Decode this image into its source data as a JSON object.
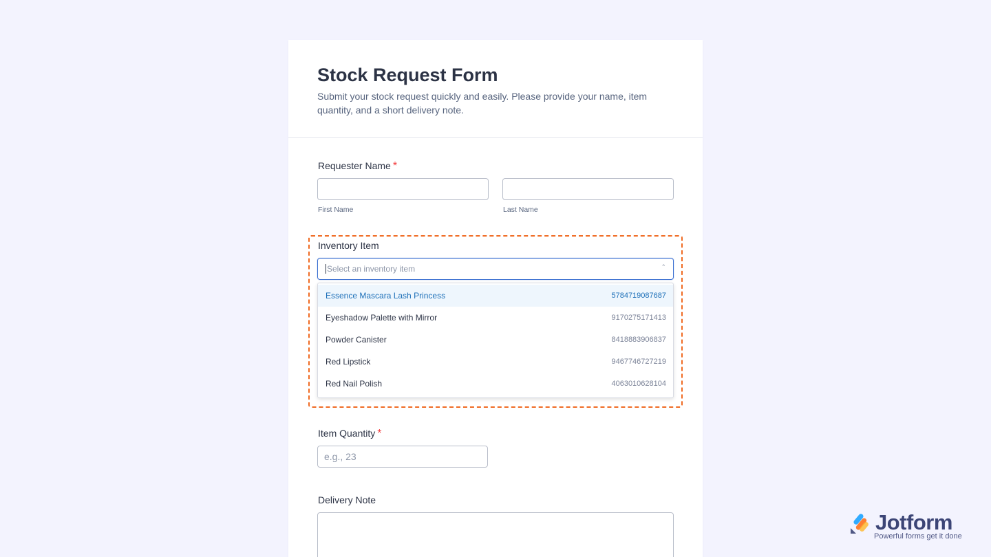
{
  "form": {
    "title": "Stock Request Form",
    "subtitle": "Submit your stock request quickly and easily. Please provide your name, item quantity, and a short delivery note."
  },
  "requester": {
    "label": "Requester Name",
    "required_mark": "*",
    "first_value": "",
    "last_value": "",
    "first_sublabel": "First Name",
    "last_sublabel": "Last Name"
  },
  "inventory": {
    "label": "Inventory Item",
    "placeholder": "Select an inventory item",
    "options": [
      {
        "name": "Essence Mascara Lash Princess",
        "code": "5784719087687",
        "active": true
      },
      {
        "name": "Eyeshadow Palette with Mirror",
        "code": "9170275171413",
        "active": false
      },
      {
        "name": "Powder Canister",
        "code": "8418883906837",
        "active": false
      },
      {
        "name": "Red Lipstick",
        "code": "9467746727219",
        "active": false
      },
      {
        "name": "Red Nail Polish",
        "code": "4063010628104",
        "active": false
      }
    ]
  },
  "quantity": {
    "label": "Item Quantity",
    "required_mark": "*",
    "value": "",
    "placeholder": "e.g., 23"
  },
  "delivery": {
    "label": "Delivery Note",
    "value": ""
  },
  "brand": {
    "name": "Jotform",
    "tagline": "Powerful forms get it done"
  },
  "colors": {
    "accent": "#1c6fb8",
    "highlight": "#f06a22",
    "required": "#f23a3c",
    "background": "#f3f3fe"
  }
}
